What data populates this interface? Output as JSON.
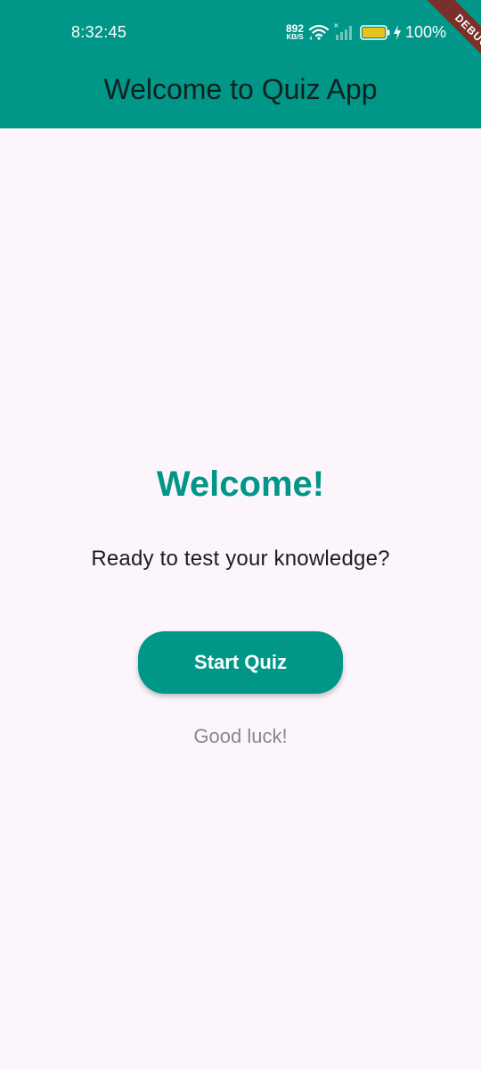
{
  "status_bar": {
    "time": "8:32:45",
    "net_speed_value": "892",
    "net_speed_unit": "KB/S",
    "battery_percent": "100%",
    "battery_level": 1.0
  },
  "debug_banner": {
    "label": "DEBUG"
  },
  "app_bar": {
    "title": "Welcome to Quiz App"
  },
  "main": {
    "heading": "Welcome!",
    "subtitle": "Ready to test your knowledge?",
    "start_button_label": "Start Quiz",
    "footer_text": "Good luck!"
  },
  "colors": {
    "primary": "#009688",
    "background": "#FCF6FC",
    "debug_banner": "#7A2F2A",
    "battery_fill": "#E6C21F"
  },
  "icons": [
    "wifi-icon",
    "signal-icon",
    "battery-icon",
    "charge-icon"
  ]
}
